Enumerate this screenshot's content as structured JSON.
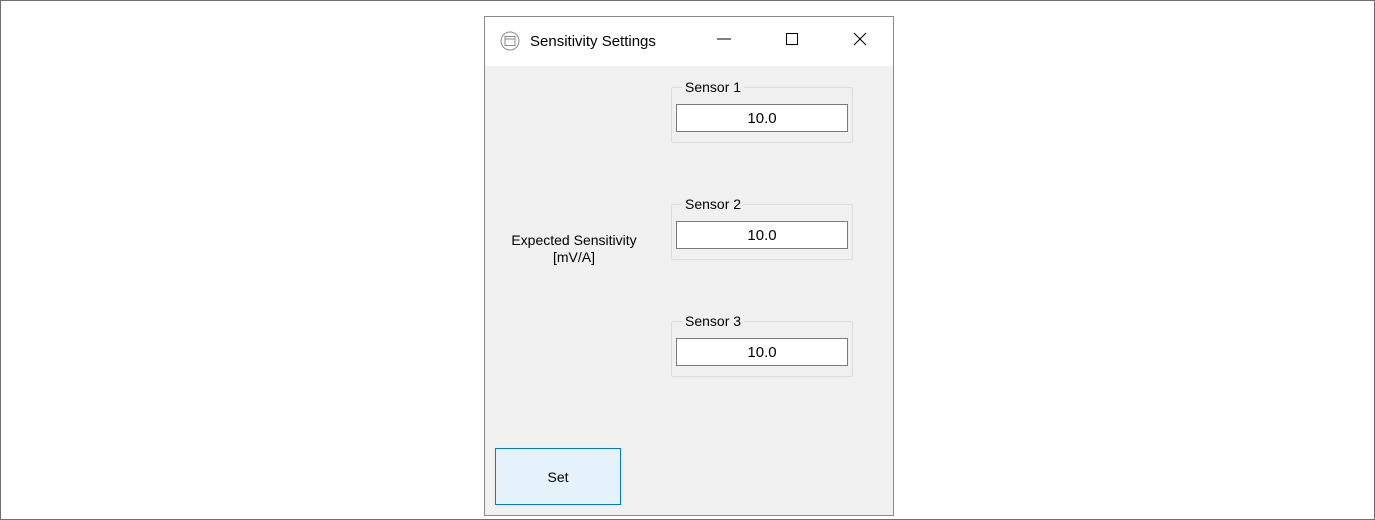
{
  "window": {
    "title": "Sensitivity Settings",
    "icon": "app-window-icon",
    "controls": {
      "minimize_icon": "minimize-icon",
      "maximize_icon": "maximize-icon",
      "close_icon": "close-icon"
    }
  },
  "label": {
    "line1": "Expected Sensitivity",
    "line2": "[mV/A]"
  },
  "sensors": [
    {
      "title": "Sensor 1",
      "value": "10.0"
    },
    {
      "title": "Sensor 2",
      "value": "10.0"
    },
    {
      "title": "Sensor 3",
      "value": "10.0"
    }
  ],
  "actions": {
    "set_label": "Set"
  },
  "colors": {
    "client_bg": "#f0f0f0",
    "titlebar_bg": "#ffffff",
    "button_border": "#0078d7",
    "button_bg": "#e5f1fb"
  }
}
